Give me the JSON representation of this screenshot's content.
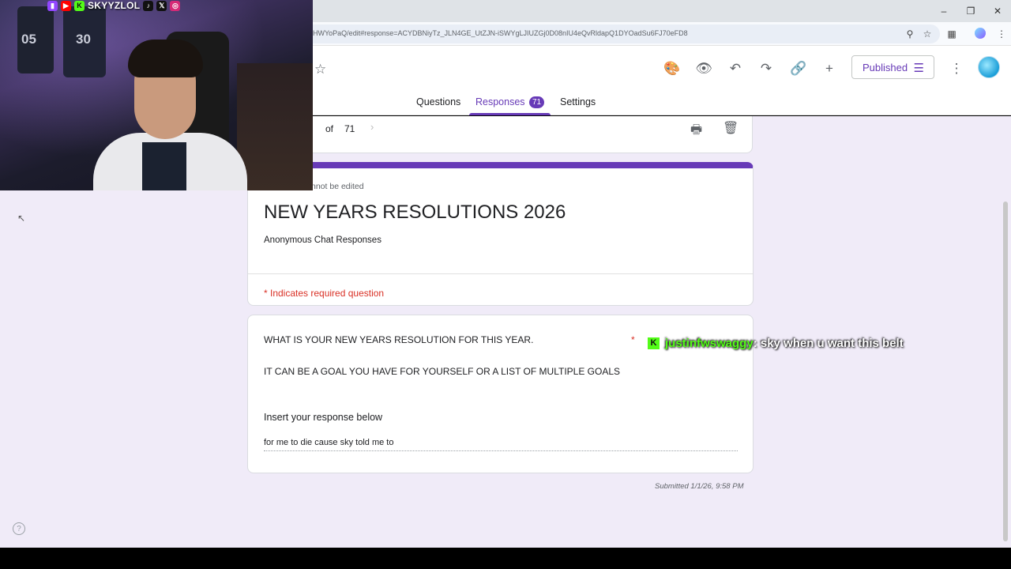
{
  "browser": {
    "url": "HWYoPaQ/edit#response=ACYDBNiyTz_JLN4GE_UtZJN-iSWYgLJIUZGj0D08nIU4eQvRldapQ1DYOadSu6FJ70eFD8"
  },
  "header": {
    "published_label": "Published"
  },
  "tabs": [
    {
      "label": "Questions"
    },
    {
      "label": "Responses",
      "badge": "71"
    },
    {
      "label": "Settings"
    }
  ],
  "response_nav": {
    "of_label": "of",
    "total": "71"
  },
  "form": {
    "cannot_edit_note": "nnot be edited",
    "title": "NEW YEARS RESOLUTIONS 2026",
    "description": "Anonymous Chat Responses",
    "required_note": "* Indicates required question"
  },
  "question": {
    "line1": "WHAT IS YOUR NEW YEARS RESOLUTION FOR THIS YEAR.",
    "line2": "IT CAN BE A GOAL YOU HAVE FOR YOURSELF OR A LIST OF MULTIPLE GOALS",
    "required_mark": "*",
    "insert_label": "Insert your response below",
    "answer": "for me to die cause sky told me to"
  },
  "submitted": "Submitted 1/1/26, 9:58 PM",
  "stream": {
    "handle": "SKYYZLOL",
    "jersey_numbers": [
      "05",
      "30"
    ],
    "chat_user": "justinfwswaggy",
    "chat_message": ": sky when u want this belt",
    "kick_color": "#53fc18"
  },
  "colors": {
    "accent": "#673ab7",
    "required": "#d93025",
    "page_bg": "#f0ebf8"
  }
}
